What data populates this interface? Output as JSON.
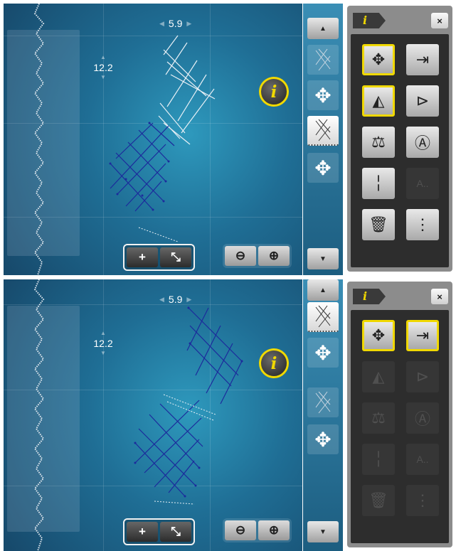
{
  "states": [
    {
      "id": "before",
      "width_value": "5.9",
      "height_value": "12.2",
      "info_label": "i",
      "panel_tab_label": "i",
      "panel_close_label": "×",
      "sidebar": {
        "up_arrow": "▲",
        "down_arrow": "▼",
        "items": [
          {
            "name": "pattern-thumb-1",
            "selected": false
          },
          {
            "name": "move-icon-1",
            "glyph": "✥"
          },
          {
            "name": "pattern-thumb-2",
            "selected": true
          },
          {
            "name": "move-icon-2",
            "glyph": "✥"
          }
        ]
      },
      "bottom_controls": {
        "group1": [
          "+",
          "⤡"
        ],
        "group2": [
          "⊖",
          "⊕"
        ]
      },
      "panel_buttons": [
        {
          "icon": "move-icon",
          "glyph": "✥",
          "state": "active"
        },
        {
          "icon": "insert-right-icon",
          "glyph": "⇥",
          "state": "normal"
        },
        {
          "icon": "mirror-horizontal-icon",
          "glyph": "◭",
          "state": "active"
        },
        {
          "icon": "mirror-vertical-icon",
          "glyph": "⊳",
          "state": "normal"
        },
        {
          "icon": "balance-icon",
          "glyph": "⚖",
          "state": "normal"
        },
        {
          "icon": "rotate-icon",
          "glyph": "Ⓐ",
          "state": "normal"
        },
        {
          "icon": "center-line-icon",
          "glyph": "╎",
          "state": "normal"
        },
        {
          "icon": "text-icon",
          "glyph": "A..",
          "state": "disabled"
        },
        {
          "icon": "trash-icon",
          "glyph": "🗑",
          "state": "normal"
        },
        {
          "icon": "dots-icon",
          "glyph": "⋮",
          "state": "normal"
        }
      ]
    },
    {
      "id": "after",
      "width_value": "5.9",
      "height_value": "12.2",
      "info_label": "i",
      "panel_tab_label": "i",
      "panel_close_label": "×",
      "sidebar": {
        "up_arrow": "▲",
        "down_arrow": "▼",
        "items": [
          {
            "name": "pattern-thumb-1",
            "selected": true
          },
          {
            "name": "move-icon-1",
            "glyph": "✥"
          },
          {
            "name": "pattern-thumb-2",
            "selected": false
          },
          {
            "name": "move-icon-2",
            "glyph": "✥"
          }
        ]
      },
      "bottom_controls": {
        "group1": [
          "+",
          "⤡"
        ],
        "group2": [
          "⊖",
          "⊕"
        ]
      },
      "panel_buttons": [
        {
          "icon": "move-icon",
          "glyph": "✥",
          "state": "active"
        },
        {
          "icon": "insert-right-icon",
          "glyph": "⇥",
          "state": "active"
        },
        {
          "icon": "mirror-horizontal-icon",
          "glyph": "◭",
          "state": "disabled"
        },
        {
          "icon": "mirror-vertical-icon",
          "glyph": "⊳",
          "state": "disabled"
        },
        {
          "icon": "balance-icon",
          "glyph": "⚖",
          "state": "disabled"
        },
        {
          "icon": "rotate-icon",
          "glyph": "Ⓐ",
          "state": "disabled"
        },
        {
          "icon": "center-line-icon",
          "glyph": "╎",
          "state": "disabled"
        },
        {
          "icon": "text-icon",
          "glyph": "A..",
          "state": "disabled"
        },
        {
          "icon": "trash-icon",
          "glyph": "🗑",
          "state": "disabled"
        },
        {
          "icon": "dots-icon",
          "glyph": "⋮",
          "state": "disabled"
        }
      ]
    }
  ],
  "colors": {
    "accent_yellow": "#f0d800",
    "stitch_white": "#e8f0f6",
    "stitch_blue": "#1c2a9c",
    "canvas_blue": "#1f6e95"
  }
}
